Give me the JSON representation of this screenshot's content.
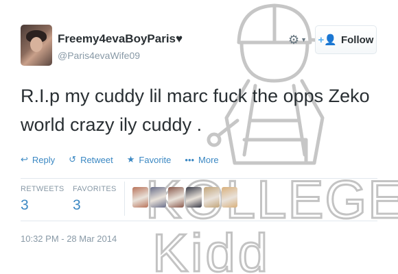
{
  "tweet": {
    "display_name": "Freemy4evaBoyParis♥",
    "handle": "@Paris4evaWife09",
    "text_line1": "R.I.p my cuddy lil marc fuck the opps Zeko",
    "text_line2": "world crazy ily cuddy .",
    "timestamp": "10:32 PM - 28 Mar 2014"
  },
  "header": {
    "gear_icon": "gear-icon",
    "follow_label": "Follow",
    "follow_icon": "add-user-icon"
  },
  "actions": [
    {
      "label": "Reply",
      "icon": "reply-icon"
    },
    {
      "label": "Retweet",
      "icon": "retweet-icon"
    },
    {
      "label": "Favorite",
      "icon": "star-icon"
    },
    {
      "label": "More",
      "icon": "more-icon"
    }
  ],
  "stats": {
    "retweets_label": "RETWEETS",
    "retweets_value": "3",
    "favorites_label": "FAVORITES",
    "favorites_value": "3"
  },
  "favoriters": [
    "#b9745b",
    "#6a6f8a",
    "#8a5a4d",
    "#3b3d4a",
    "#c2a57a",
    "#d8b07c"
  ],
  "watermark": {
    "line1": "KOLLEGE",
    "line2": "Kidd"
  },
  "colors": {
    "link": "#3b88c3",
    "muted": "#8899a6",
    "text": "#292f33",
    "accent": "#55acee"
  }
}
